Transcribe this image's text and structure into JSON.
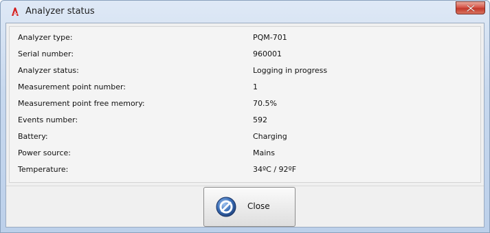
{
  "window": {
    "title": "Analyzer status",
    "app_icon": "analyzer-app-icon",
    "close_icon": "close-x-icon"
  },
  "status": {
    "rows": [
      {
        "label": "Analyzer type:",
        "value": "PQM-701"
      },
      {
        "label": "Serial number:",
        "value": "960001"
      },
      {
        "label": "Analyzer status:",
        "value": "Logging in progress"
      },
      {
        "label": "Measurement point number:",
        "value": "1"
      },
      {
        "label": "Measurement point free memory:",
        "value": "70.5%"
      },
      {
        "label": "Events number:",
        "value": "592"
      },
      {
        "label": "Battery:",
        "value": "Charging"
      },
      {
        "label": "Power source:",
        "value": "Mains"
      },
      {
        "label": "Temperature:",
        "value": "34ºC / 92ºF"
      }
    ]
  },
  "footer": {
    "close_label": "Close",
    "close_icon": "close-circle-icon"
  },
  "colors": {
    "title_close_red": "#c9473a",
    "app_icon_red": "#d21f1f",
    "panel_bg": "#f4f4f4",
    "client_bg": "#f0f0f0"
  }
}
